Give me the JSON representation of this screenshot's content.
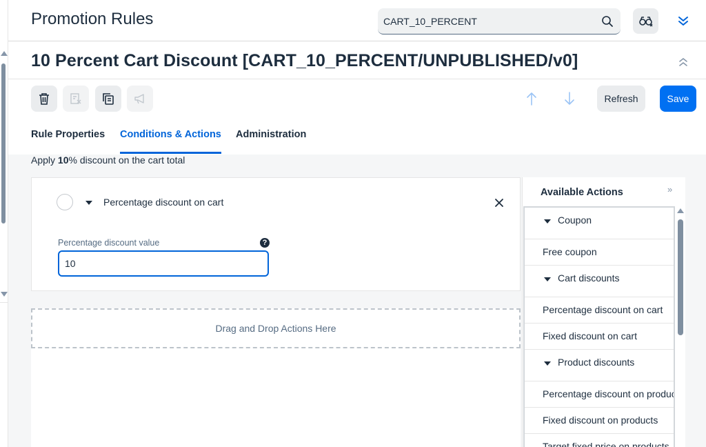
{
  "header": {
    "page_title": "Promotion Rules",
    "search_value": "CART_10_PERCENT"
  },
  "object": {
    "title": "10 Percent Cart Discount [CART_10_PERCENT/UNPUBLISHED/v0]"
  },
  "toolbar": {
    "refresh_label": "Refresh",
    "save_label": "Save"
  },
  "tabs": [
    {
      "label": "Rule Properties"
    },
    {
      "label": "Conditions & Actions"
    },
    {
      "label": "Administration"
    }
  ],
  "summary": {
    "prefix": "Apply ",
    "value": "10",
    "suffix": "% discount on the cart total"
  },
  "action": {
    "title": "Percentage discount on cart",
    "field_label": "Percentage discount value",
    "field_value": "10"
  },
  "dropzone": {
    "label": "Drag and Drop Actions Here"
  },
  "available_actions": {
    "title": "Available Actions",
    "items": [
      {
        "label": "Coupon",
        "group": true
      },
      {
        "label": "Free coupon",
        "group": false
      },
      {
        "label": "Cart discounts",
        "group": true
      },
      {
        "label": "Percentage discount on cart",
        "group": false
      },
      {
        "label": "Fixed discount on cart",
        "group": false
      },
      {
        "label": "Product discounts",
        "group": true
      },
      {
        "label": "Percentage discount on products",
        "group": false
      },
      {
        "label": "Fixed discount on products",
        "group": false
      },
      {
        "label": "Target fixed price on products",
        "group": false
      }
    ]
  },
  "colors": {
    "accent": "#0064d9",
    "save": "#0070f2",
    "text": "#1d2d3e"
  }
}
